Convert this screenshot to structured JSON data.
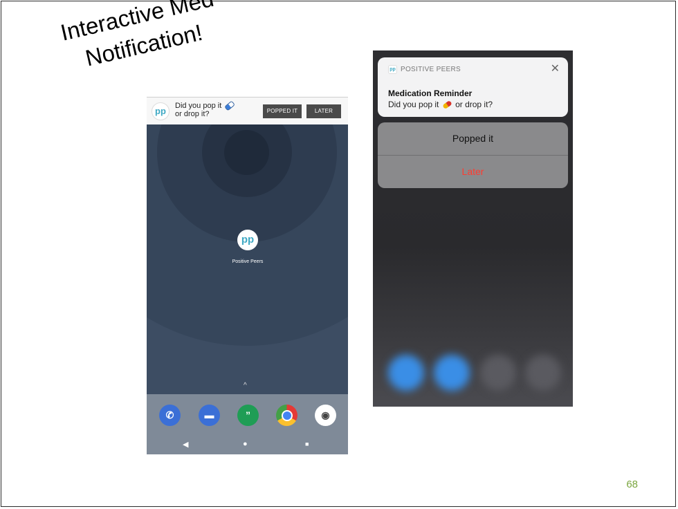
{
  "slide": {
    "title_line1": "Interactive Med",
    "title_line2": "Notification!",
    "page_number": "68"
  },
  "android": {
    "notification": {
      "app_logo": "pp",
      "text_line1": "Did you pop it",
      "text_line2": "or drop it?",
      "icon": "pill-icon",
      "popped_button": "POPPED IT",
      "later_button": "LATER"
    },
    "home": {
      "app_icon_text": "pp",
      "app_label": "Positive Peers",
      "up_chevron": "^"
    },
    "dock": [
      {
        "name": "phone-icon",
        "color": "#3b6fd6"
      },
      {
        "name": "messages-icon",
        "color": "#3b6fd6"
      },
      {
        "name": "hangouts-icon",
        "color": "#1f9d55"
      },
      {
        "name": "chrome-icon",
        "color": "#e8a317"
      },
      {
        "name": "camera-icon",
        "color": "#ffffff"
      }
    ],
    "nav": {
      "back": "◀",
      "home": "●",
      "recents": "■"
    }
  },
  "ios": {
    "app_name": "POSITIVE PEERS",
    "close": "✕",
    "title": "Medication Reminder",
    "body_part1": "Did you pop it",
    "body_part2": "or drop it?",
    "action_popped": "Popped it",
    "action_later": "Later",
    "later_color": "#ff3b30"
  }
}
